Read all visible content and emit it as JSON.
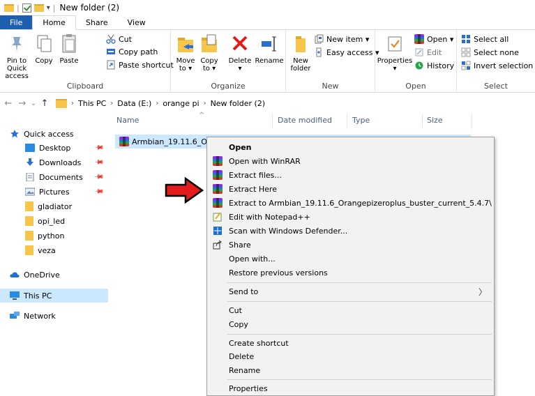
{
  "window": {
    "title": "New folder (2)"
  },
  "tabs": [
    "File",
    "Home",
    "Share",
    "View"
  ],
  "ribbon": {
    "clipboard": {
      "label": "Clipboard",
      "pin_label_1": "Pin to Quick",
      "pin_label_2": "access",
      "copy": "Copy",
      "paste": "Paste",
      "cut": "Cut",
      "copy_path": "Copy path",
      "paste_shortcut": "Paste shortcut"
    },
    "organize": {
      "label": "Organize",
      "move_to_1": "Move",
      "move_to_2": "to ▾",
      "copy_to_1": "Copy",
      "copy_to_2": "to ▾",
      "delete": "Delete",
      "delete_arrow": "▾",
      "rename": "Rename"
    },
    "new": {
      "label": "New",
      "new_folder_1": "New",
      "new_folder_2": "folder",
      "new_item": "New item ▾",
      "easy_access": "Easy access ▾"
    },
    "open": {
      "label": "Open",
      "properties": "Properties",
      "properties_arrow": "▾",
      "open": "Open ▾",
      "edit": "Edit",
      "history": "History"
    },
    "select": {
      "label": "Select",
      "select_all": "Select all",
      "select_none": "Select none",
      "invert_selection": "Invert selection"
    }
  },
  "address": {
    "breadcrumbs": [
      "This PC",
      "Data (E:)",
      "orange pi",
      "New folder (2)"
    ],
    "separator": "›"
  },
  "nav_pane": {
    "quick_access": "Quick access",
    "items": [
      "Desktop",
      "Downloads",
      "Documents",
      "Pictures",
      "gladiator",
      "opi_led",
      "python",
      "veza"
    ],
    "onedrive": "OneDrive",
    "this_pc": "This PC",
    "network": "Network"
  },
  "columns": {
    "name": "Name",
    "date_modified": "Date modified",
    "type": "Type",
    "size": "Size"
  },
  "files": [
    {
      "name": "Armbian_19.11.6_Orang"
    }
  ],
  "context_menu": {
    "open": "Open",
    "open_with_winrar": "Open with WinRAR",
    "extract_files": "Extract files...",
    "extract_here": "Extract Here",
    "extract_to": "Extract to Armbian_19.11.6_Orangepizeroplus_buster_current_5.4.7\\",
    "edit_notepad": "Edit with Notepad++",
    "scan_defender": "Scan with Windows Defender...",
    "share": "Share",
    "open_with": "Open with...",
    "restore_versions": "Restore previous versions",
    "send_to": "Send to",
    "cut": "Cut",
    "copy": "Copy",
    "create_shortcut": "Create shortcut",
    "delete": "Delete",
    "rename": "Rename",
    "properties": "Properties"
  },
  "colors": {
    "accent": "#1f5fb0",
    "selection": "#cce8ff",
    "arrow": "#e31b1b",
    "folder": "#f5c64a"
  }
}
